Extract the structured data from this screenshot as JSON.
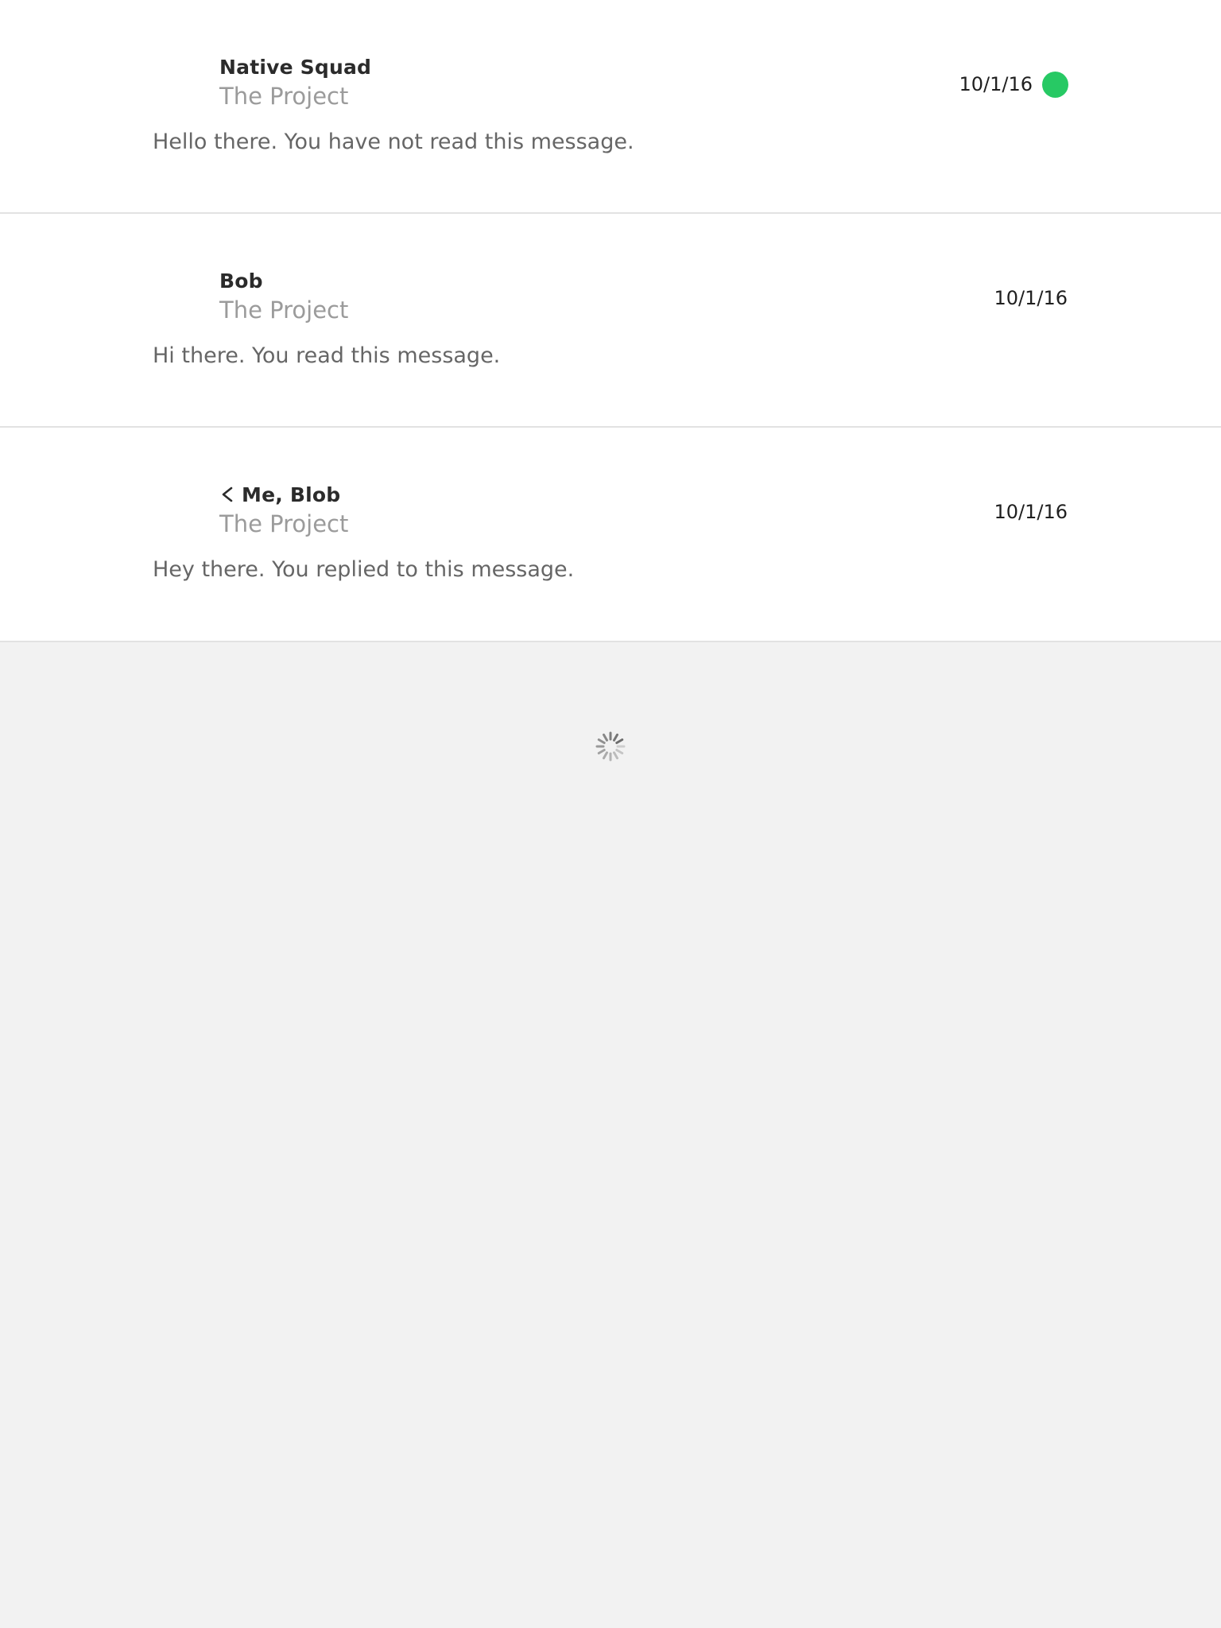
{
  "colors": {
    "unread_dot": "#27c964",
    "row_background": "#ffffff",
    "page_background": "#f2f2f2",
    "divider": "#e2e2e2",
    "sender_text": "#2b2b2b",
    "project_text": "#9b9b9b",
    "preview_text": "#666666",
    "date_text": "#1f1f1f"
  },
  "messages": [
    {
      "sender": "Native Squad",
      "project": "The Project",
      "preview": "Hello there. You have not read this message.",
      "date": "10/1/16",
      "unread": true,
      "replied": false
    },
    {
      "sender": "Bob",
      "project": "The Project",
      "preview": "Hi there. You read this message.",
      "date": "10/1/16",
      "unread": false,
      "replied": false
    },
    {
      "sender": "Me, Blob",
      "project": "The Project",
      "preview": "Hey there. You replied to this message.",
      "date": "10/1/16",
      "unread": false,
      "replied": true
    }
  ],
  "icons": {
    "reply": "reply-arrow-icon",
    "unread": "unread-dot-icon",
    "loading": "loading-spinner-icon"
  }
}
